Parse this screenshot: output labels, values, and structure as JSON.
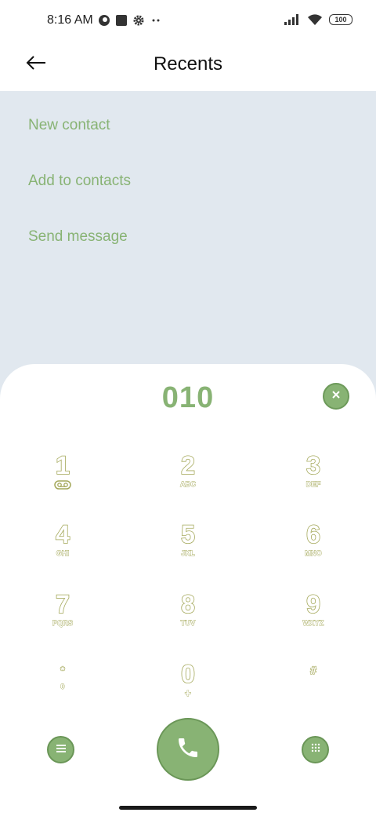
{
  "status_bar": {
    "time": "8:16 AM",
    "battery": "100",
    "left_icons": [
      "vpn-key-icon",
      "square-app-icon",
      "settings-gear-icon",
      "more-dots-icon"
    ],
    "right_icons": [
      "cell-signal-icon",
      "wifi-icon",
      "battery-icon"
    ]
  },
  "header": {
    "title": "Recents",
    "back_icon": "arrow-left-icon"
  },
  "options": [
    {
      "label": "New contact"
    },
    {
      "label": "Add to contacts"
    },
    {
      "label": "Send message"
    }
  ],
  "dialer": {
    "number": "010",
    "clear_icon": "close-icon",
    "keys": [
      {
        "digit": "1",
        "letters": "",
        "sub_icon": "voicemail-icon"
      },
      {
        "digit": "2",
        "letters": "ABC"
      },
      {
        "digit": "3",
        "letters": "DEF"
      },
      {
        "digit": "4",
        "letters": "GHI"
      },
      {
        "digit": "5",
        "letters": "JKL"
      },
      {
        "digit": "6",
        "letters": "MNO"
      },
      {
        "digit": "7",
        "letters": "PQRS"
      },
      {
        "digit": "8",
        "letters": "TUV"
      },
      {
        "digit": "9",
        "letters": "WXYZ"
      },
      {
        "digit": "*",
        "letters": "0"
      },
      {
        "digit": "0",
        "letters": "+"
      },
      {
        "digit": "#",
        "letters": ""
      }
    ],
    "menu_icon": "menu-icon",
    "call_icon": "phone-icon",
    "keypad_icon": "dialpad-icon"
  },
  "colors": {
    "accent": "#88b374",
    "key_outline": "#a4a85a",
    "options_bg": "#e1e8ef"
  }
}
